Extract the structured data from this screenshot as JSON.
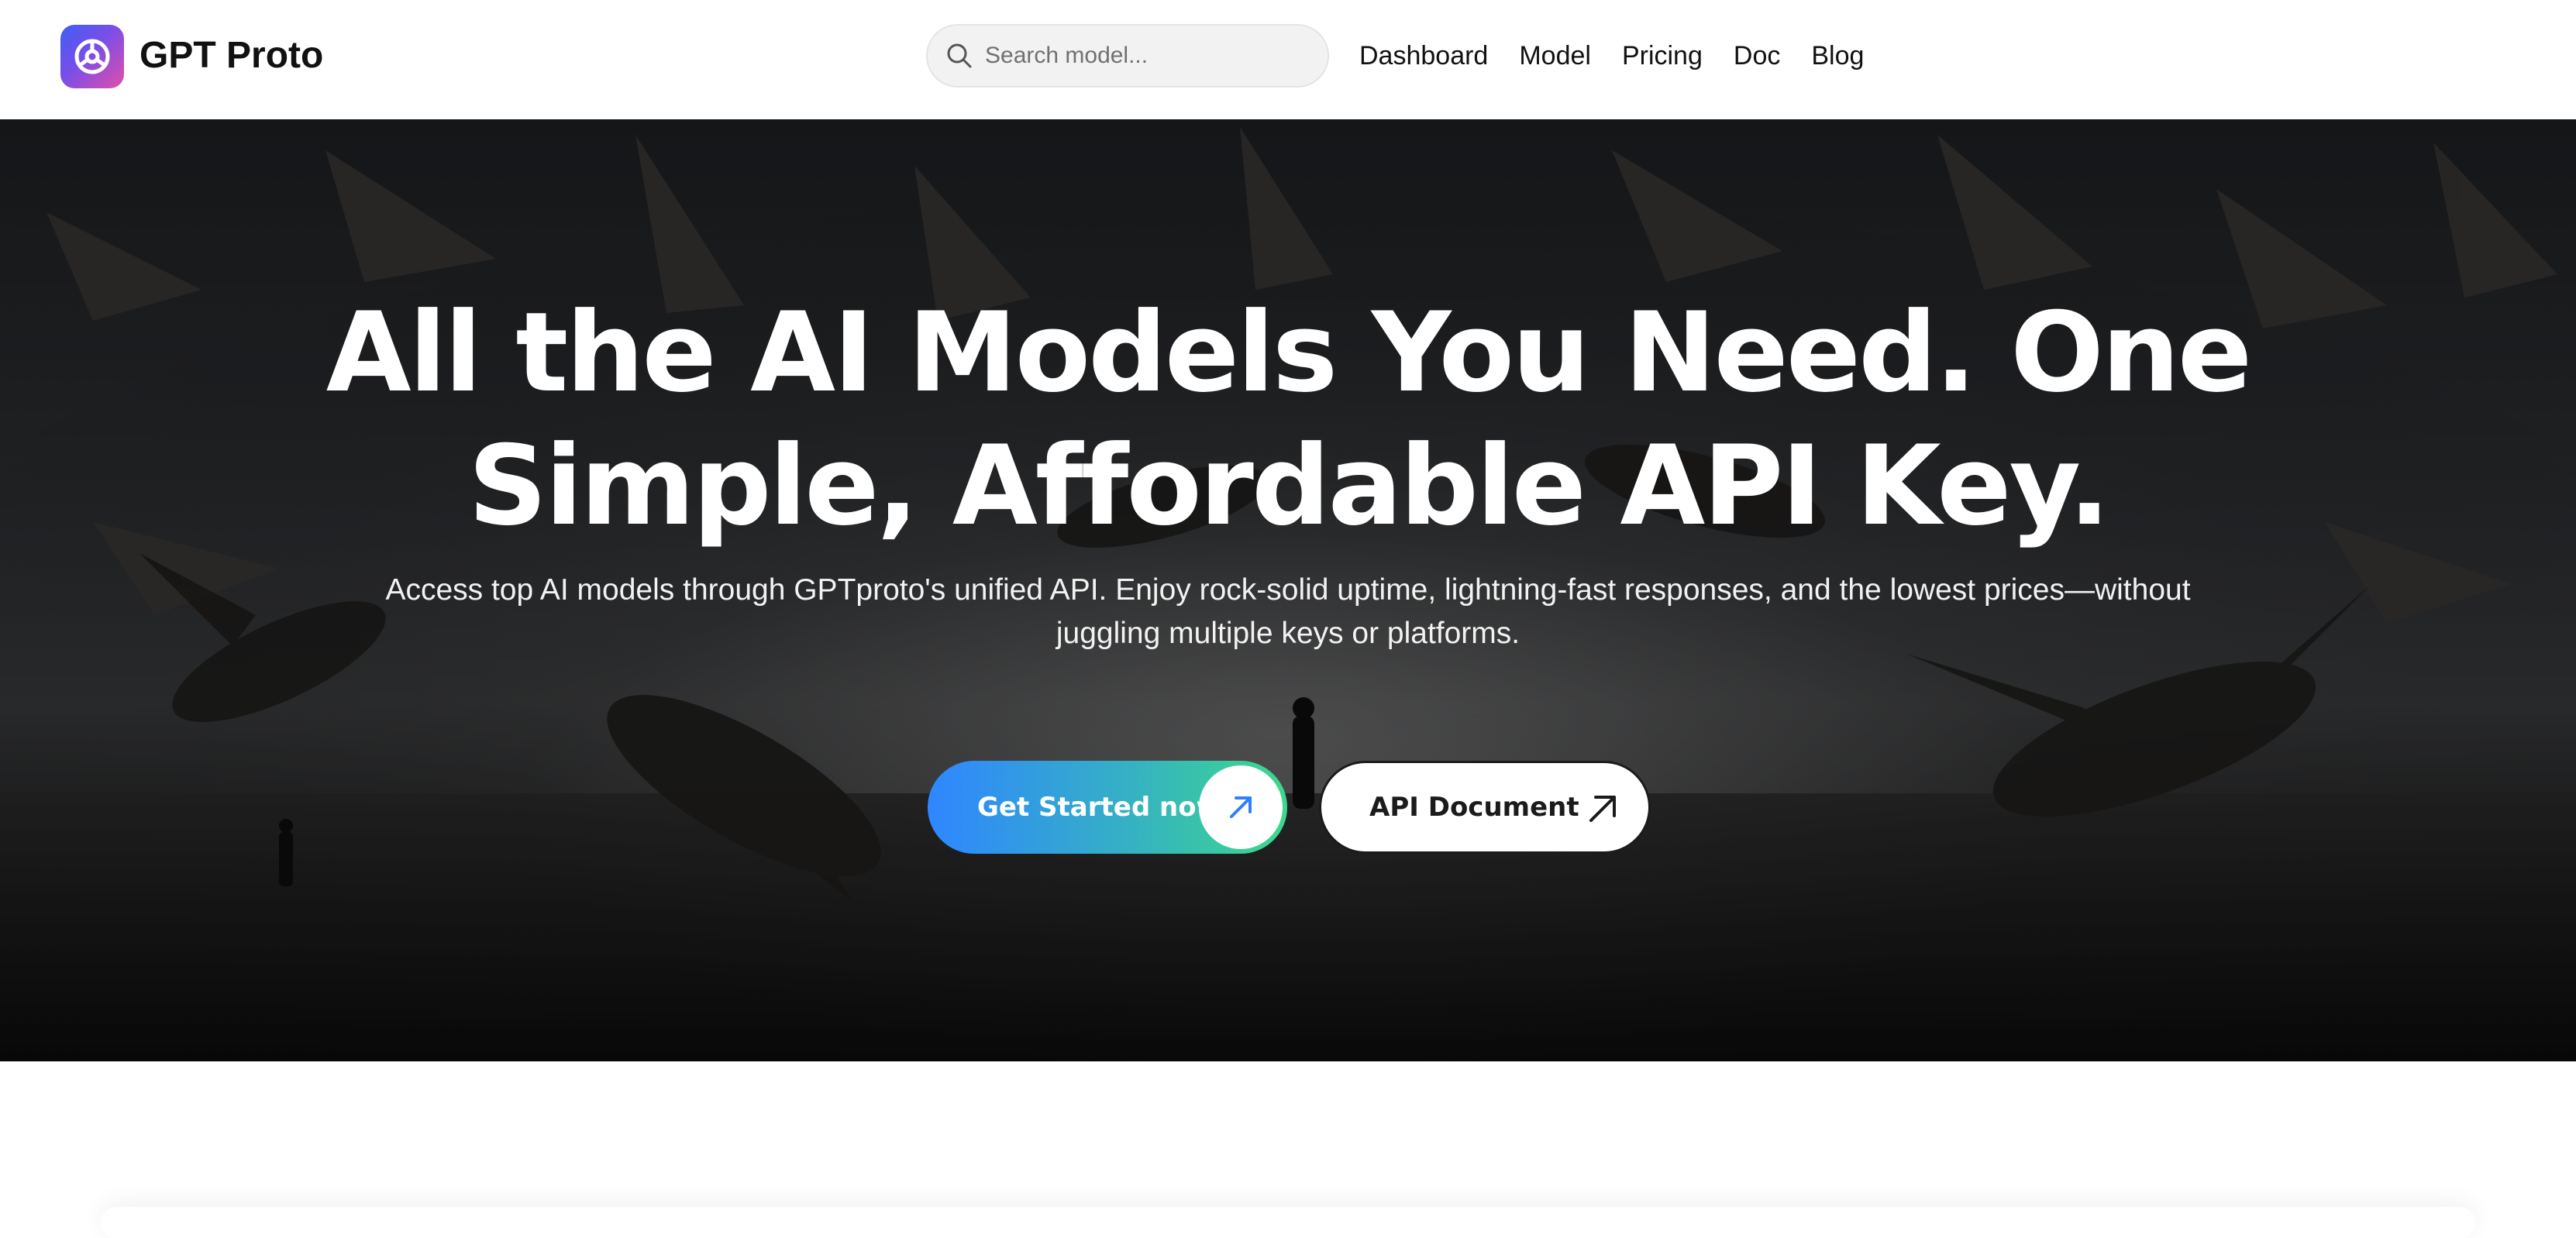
{
  "brand": {
    "name": "GPT Proto",
    "logo_icon": "gptproto-logo-icon",
    "logo_gradient": [
      "#3d5ef5",
      "#7a4ee8",
      "#e24fa6"
    ]
  },
  "search": {
    "placeholder": "Search model..."
  },
  "nav": {
    "items": [
      {
        "label": "Dashboard"
      },
      {
        "label": "Model"
      },
      {
        "label": "Pricing"
      },
      {
        "label": "Doc"
      },
      {
        "label": "Blog"
      }
    ]
  },
  "hero": {
    "title": "All the AI Models You Need. One Simple, Affordable API Key.",
    "subtitle": "Access top AI models through GPTproto's unified API. Enjoy rock-solid uptime, lightning-fast responses, and the lowest prices—without juggling multiple keys or platforms.",
    "primary_button": {
      "label": "Get Started now",
      "icon": "arrow-up-right-icon",
      "gradient": [
        "#2f86ff",
        "#3cd98b"
      ]
    },
    "secondary_button": {
      "label": "API Document",
      "icon": "arrow-up-right-icon"
    }
  }
}
